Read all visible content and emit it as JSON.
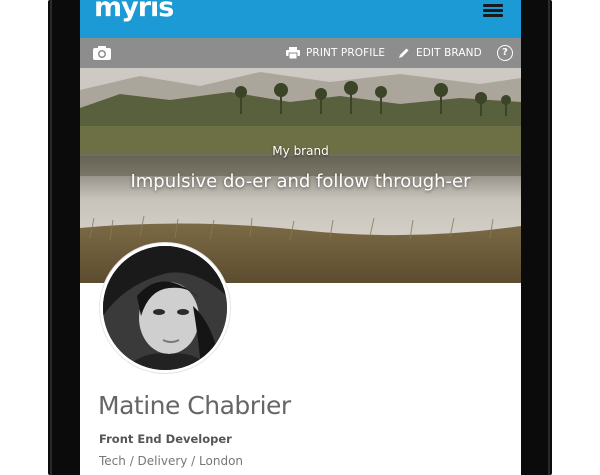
{
  "app": {
    "logo_text": "myris"
  },
  "toolbar": {
    "print_label": "PRINT PROFILE",
    "edit_label": "EDIT BRAND",
    "help_label": "?"
  },
  "hero": {
    "brand_label": "My brand",
    "tagline": "Impulsive do-er and follow through-er"
  },
  "profile": {
    "name": "Matine Chabrier",
    "role": "Front End Developer",
    "tags": "Tech / Delivery / London"
  },
  "colors": {
    "header": "#1b9ad6",
    "toolbar": "#8d8d8d",
    "name_text": "#666666"
  },
  "icons": [
    "menu-icon",
    "camera-icon",
    "printer-icon",
    "pencil-icon",
    "help-icon"
  ]
}
